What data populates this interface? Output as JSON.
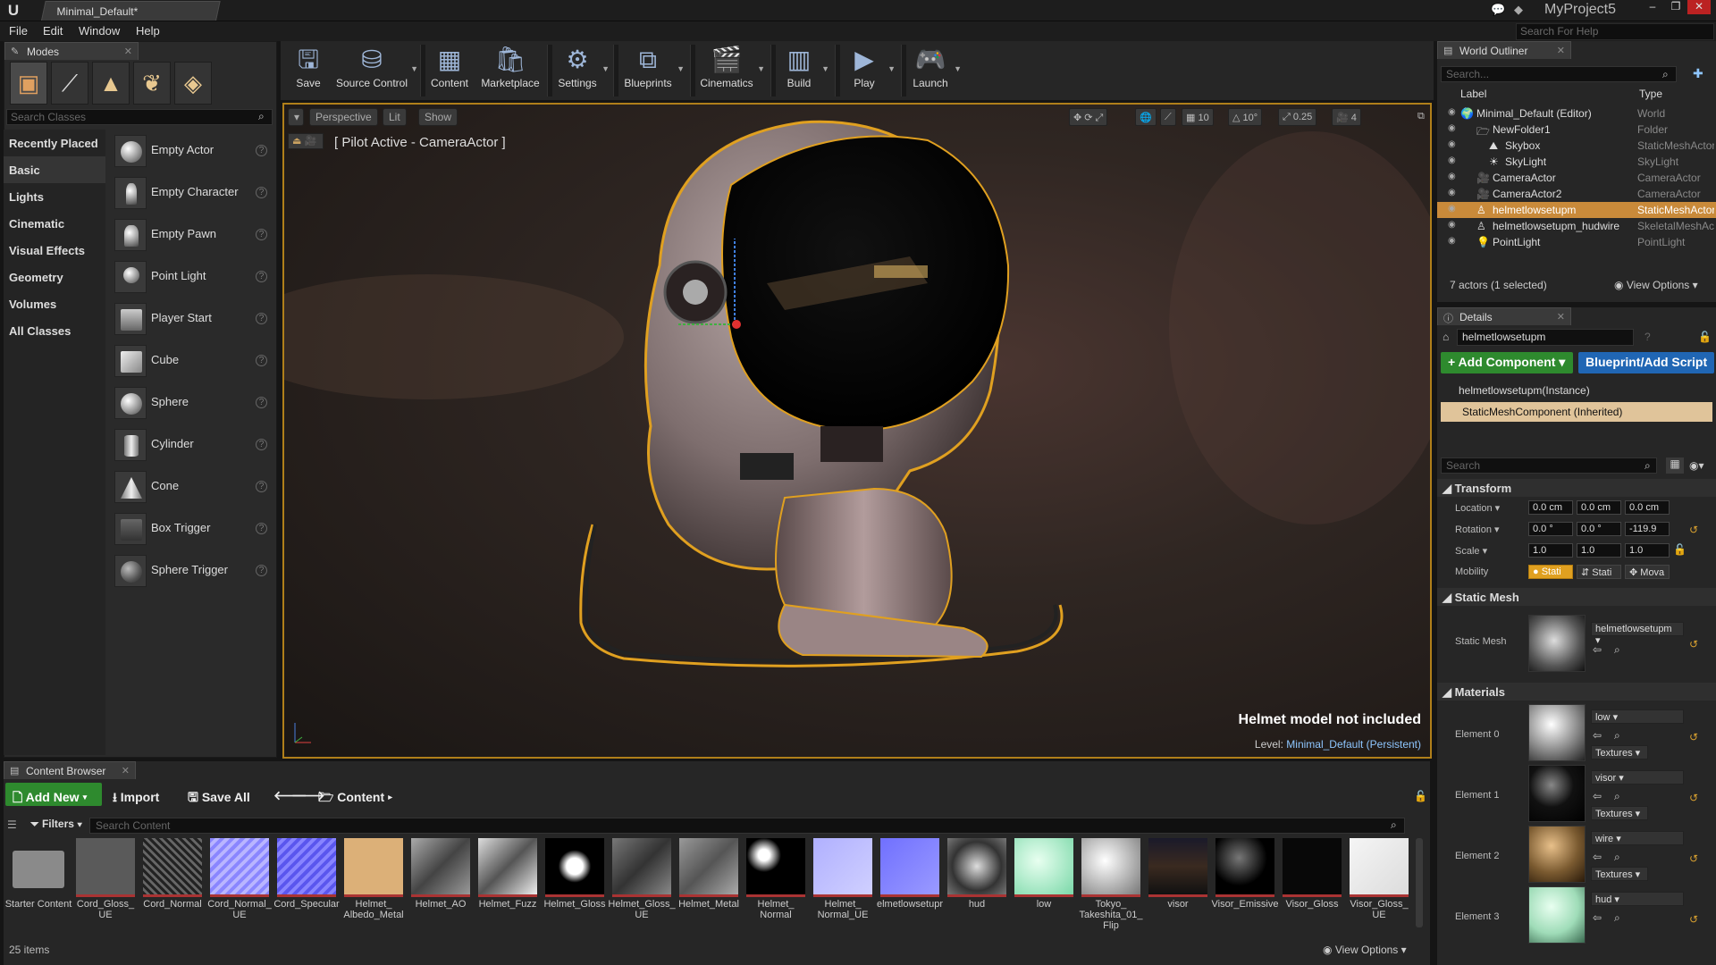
{
  "app": {
    "doc_tab": "Minimal_Default*",
    "project": "MyProject5",
    "help_search_placeholder": "Search For Help"
  },
  "menu": [
    "File",
    "Edit",
    "Window",
    "Help"
  ],
  "modes": {
    "tab": "Modes",
    "search_placeholder": "Search Classes",
    "categories": [
      "Recently Placed",
      "Basic",
      "Lights",
      "Cinematic",
      "Visual Effects",
      "Geometry",
      "Volumes",
      "All Classes"
    ],
    "actors": [
      "Empty Actor",
      "Empty Character",
      "Empty Pawn",
      "Point Light",
      "Player Start",
      "Cube",
      "Sphere",
      "Cylinder",
      "Cone",
      "Box Trigger",
      "Sphere Trigger"
    ]
  },
  "toolbar": {
    "save": "Save",
    "source_control": "Source Control",
    "content": "Content",
    "marketplace": "Marketplace",
    "settings": "Settings",
    "blueprints": "Blueprints",
    "cinematics": "Cinematics",
    "build": "Build",
    "play": "Play",
    "launch": "Launch"
  },
  "viewport": {
    "perspective": "Perspective",
    "lit": "Lit",
    "show": "Show",
    "pilot": "[ Pilot Active - CameraActor ]",
    "grid": "10",
    "angle": "10°",
    "scale": "0.25",
    "cam_speed": "4",
    "note": "Helmet model not included",
    "level_label": "Level:",
    "level_name": "Minimal_Default (Persistent)"
  },
  "outliner": {
    "tab": "World Outliner",
    "search_placeholder": "Search...",
    "col_label": "Label",
    "col_type": "Type",
    "rows": [
      {
        "label": "Minimal_Default (Editor)",
        "type": "World"
      },
      {
        "label": "NewFolder1",
        "type": "Folder"
      },
      {
        "label": "Skybox",
        "type": "StaticMeshActor"
      },
      {
        "label": "SkyLight",
        "type": "SkyLight"
      },
      {
        "label": "CameraActor",
        "type": "CameraActor"
      },
      {
        "label": "CameraActor2",
        "type": "CameraActor"
      },
      {
        "label": "helmetlowsetupm",
        "type": "StaticMeshActor"
      },
      {
        "label": "helmetlowsetupm_hudwire",
        "type": "SkeletalMeshActor"
      },
      {
        "label": "PointLight",
        "type": "PointLight"
      }
    ],
    "footer": "7 actors (1 selected)",
    "view_options": "View Options"
  },
  "details": {
    "tab": "Details",
    "name": "helmetlowsetupm",
    "add_component": "+ Add Component",
    "blueprint": "Blueprint/Add Script",
    "instance": "helmetlowsetupm(Instance)",
    "component": "StaticMeshComponent (Inherited)",
    "search_placeholder": "Search",
    "transform": {
      "header": "Transform",
      "location_label": "Location",
      "rotation_label": "Rotation",
      "scale_label": "Scale",
      "mobility_label": "Mobility",
      "location": [
        "0.0 cm",
        "0.0 cm",
        "0.0 cm"
      ],
      "rotation": [
        "0.0 °",
        "0.0 °",
        "-119.9"
      ],
      "scale": [
        "1.0",
        "1.0",
        "1.0"
      ],
      "mobility": [
        "Stati",
        "Stati",
        "Mova"
      ]
    },
    "static_mesh": {
      "header": "Static Mesh",
      "label": "Static Mesh",
      "value": "helmetlowsetupm"
    },
    "materials": {
      "header": "Materials",
      "textures_label": "Textures",
      "elements": [
        {
          "label": "Element 0",
          "value": "low"
        },
        {
          "label": "Element 1",
          "value": "visor"
        },
        {
          "label": "Element 2",
          "value": "wire"
        },
        {
          "label": "Element 3",
          "value": "hud"
        }
      ]
    }
  },
  "content_browser": {
    "tab": "Content Browser",
    "add_new": "Add New",
    "import": "Import",
    "save_all": "Save All",
    "path": "Content",
    "filters": "Filters",
    "search_placeholder": "Search Content",
    "assets": [
      "Starter Content",
      "Cord_Gloss_ UE",
      "Cord_Normal",
      "Cord_Normal_ UE",
      "Cord_Specular",
      "Helmet_ Albedo_Metal",
      "Helmet_AO",
      "Helmet_Fuzz",
      "Helmet_Gloss",
      "Helmet_Gloss_ UE",
      "Helmet_Metal",
      "Helmet_ Normal",
      "Helmet_ Normal_UE",
      "elmetlowsetupr",
      "hud",
      "low",
      "Tokyo_ Takeshita_01_ Flip",
      "visor",
      "Visor_Emissive",
      "Visor_Gloss",
      "Visor_Gloss_ UE"
    ],
    "count": "25 items",
    "view_options": "View Options"
  }
}
